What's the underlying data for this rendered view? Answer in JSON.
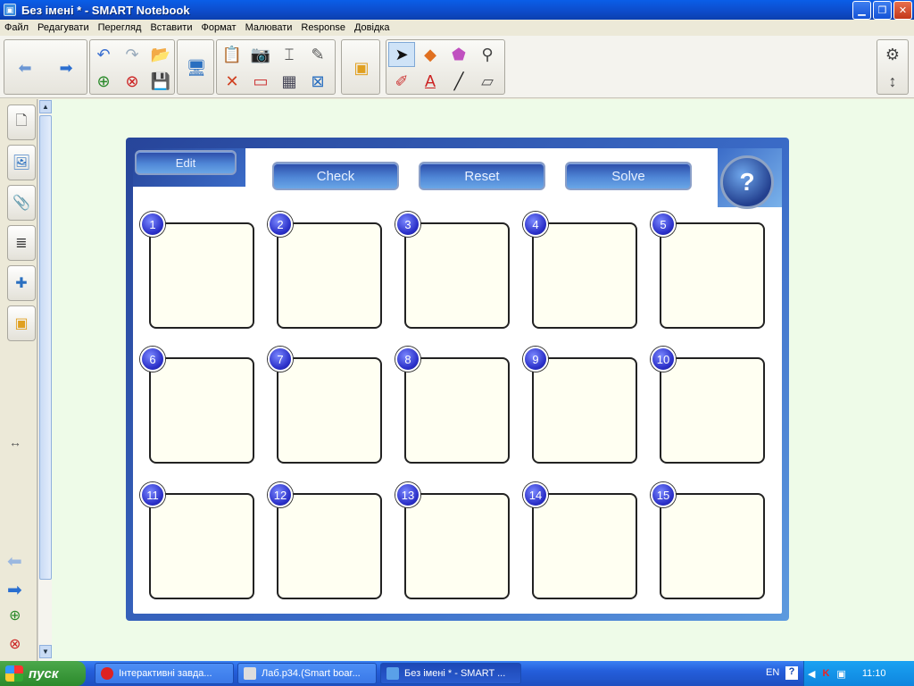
{
  "window": {
    "title": "Без імені * - SMART Notebook"
  },
  "menu": [
    "Файл",
    "Редагувати",
    "Перегляд",
    "Вставити",
    "Формат",
    "Малювати",
    "Response",
    "Довідка"
  ],
  "activity": {
    "edit_label": "Edit",
    "check_label": "Check",
    "reset_label": "Reset",
    "solve_label": "Solve",
    "help_label": "?",
    "cells": [
      "1",
      "2",
      "3",
      "4",
      "5",
      "6",
      "7",
      "8",
      "9",
      "10",
      "11",
      "12",
      "13",
      "14",
      "15"
    ]
  },
  "taskbar": {
    "start_label": "пуск",
    "tasks": [
      "Інтерактивні завда...",
      "Лаб.р34.(Smart boar...",
      "Без імені * - SMART ..."
    ],
    "lang": "EN",
    "clock": "11:10"
  },
  "colors": {
    "panel": "#3b6cc8",
    "canvas": "#eefbe8",
    "cell_bg": "#fffff2"
  }
}
